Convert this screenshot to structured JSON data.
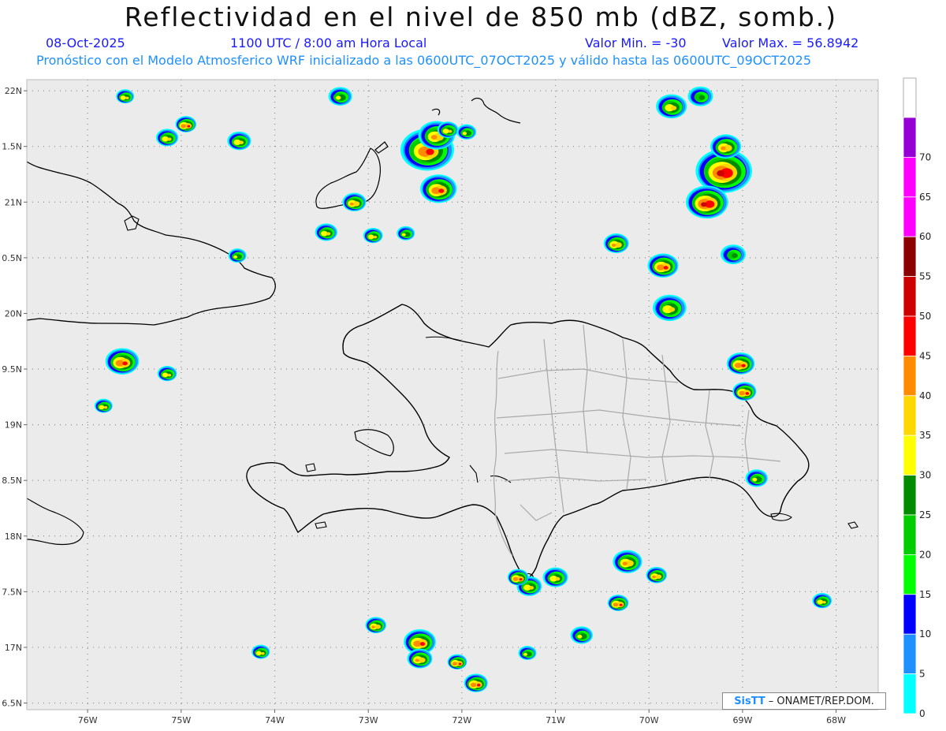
{
  "title": "Reflectividad en el nivel de 850 mb (dBZ, somb.)",
  "date": "08-Oct-2025",
  "time_label": "1100 UTC / 8:00 am Hora Local",
  "min_label": "Valor Min. = -30",
  "max_label": "Valor Max. = 56.8942",
  "forecast_label": "Pronóstico con el Modelo Atmosferico WRF inicializado a las 0600UTC_07OCT2025 y válido hasta las  0600UTC_09OCT2025",
  "credit": {
    "logo": "SisTT",
    "text": "– ONAMET/REP.DOM."
  },
  "map": {
    "lon_range": [
      -76.65,
      -67.55
    ],
    "lat_range": [
      16.44,
      22.1
    ],
    "lon_ticks": [
      {
        "value": -76,
        "label": "76W"
      },
      {
        "value": -75,
        "label": "75W"
      },
      {
        "value": -74,
        "label": "74W"
      },
      {
        "value": -73,
        "label": "73W"
      },
      {
        "value": -72,
        "label": "72W"
      },
      {
        "value": -71,
        "label": "71W"
      },
      {
        "value": -70,
        "label": "70W"
      },
      {
        "value": -69,
        "label": "69W"
      },
      {
        "value": -68,
        "label": "68W"
      }
    ],
    "lat_ticks": [
      {
        "value": 22,
        "label": "22N"
      },
      {
        "value": 21.5,
        "label": "1.5N"
      },
      {
        "value": 21,
        "label": "21N"
      },
      {
        "value": 20.5,
        "label": "0.5N"
      },
      {
        "value": 20,
        "label": "20N"
      },
      {
        "value": 19.5,
        "label": "9.5N"
      },
      {
        "value": 19,
        "label": "19N"
      },
      {
        "value": 18.5,
        "label": "8.5N"
      },
      {
        "value": 18,
        "label": "18N"
      },
      {
        "value": 17.5,
        "label": "7.5N"
      },
      {
        "value": 17,
        "label": "17N"
      },
      {
        "value": 16.5,
        "label": "6.5N"
      }
    ],
    "grid": true,
    "colors": {
      "background": "#ebebeb",
      "coast": "#000000",
      "borders": "#a9a9a9"
    }
  },
  "colorbar": {
    "labels": [
      "0",
      "5",
      "10",
      "15",
      "20",
      "25",
      "30",
      "35",
      "40",
      "45",
      "50",
      "55",
      "60",
      "65",
      "70"
    ],
    "colors": [
      "#00ffff",
      "#1e90ff",
      "#0000ff",
      "#00ff00",
      "#00cd00",
      "#008b00",
      "#ffff00",
      "#ffd700",
      "#ff8c00",
      "#ff0000",
      "#cd0000",
      "#8b0000",
      "#ff00ff",
      "#ff00ff",
      "#9400d3"
    ],
    "under_color": "#e6e6e6"
  },
  "storm_cells": [
    {
      "lon": -72.37,
      "lat": 21.47,
      "size": 3.0,
      "max": 48
    },
    {
      "lon": -72.27,
      "lat": 21.6,
      "size": 1.8,
      "max": 44
    },
    {
      "lon": -72.25,
      "lat": 21.12,
      "size": 1.8,
      "max": 46
    },
    {
      "lon": -69.2,
      "lat": 21.28,
      "size": 3.2,
      "max": 50
    },
    {
      "lon": -69.38,
      "lat": 21.0,
      "size": 2.2,
      "max": 50
    },
    {
      "lon": -69.18,
      "lat": 21.5,
      "size": 1.4,
      "max": 40
    },
    {
      "lon": -69.76,
      "lat": 21.86,
      "size": 1.4,
      "max": 38
    },
    {
      "lon": -69.45,
      "lat": 21.95,
      "size": 1.0,
      "max": 25
    },
    {
      "lon": -69.85,
      "lat": 20.43,
      "size": 1.4,
      "max": 46
    },
    {
      "lon": -70.35,
      "lat": 20.63,
      "size": 1.0,
      "max": 40
    },
    {
      "lon": -69.78,
      "lat": 20.05,
      "size": 1.6,
      "max": 38
    },
    {
      "lon": -69.02,
      "lat": 19.55,
      "size": 1.2,
      "max": 46
    },
    {
      "lon": -68.98,
      "lat": 19.3,
      "size": 0.9,
      "max": 48
    },
    {
      "lon": -69.1,
      "lat": 20.53,
      "size": 1.0,
      "max": 25
    },
    {
      "lon": -75.63,
      "lat": 19.57,
      "size": 1.6,
      "max": 48
    },
    {
      "lon": -75.15,
      "lat": 19.46,
      "size": 0.6,
      "max": 35
    },
    {
      "lon": -75.15,
      "lat": 21.58,
      "size": 0.8,
      "max": 38
    },
    {
      "lon": -74.95,
      "lat": 21.7,
      "size": 0.7,
      "max": 48
    },
    {
      "lon": -74.38,
      "lat": 21.55,
      "size": 0.9,
      "max": 38
    },
    {
      "lon": -73.45,
      "lat": 20.73,
      "size": 0.8,
      "max": 38
    },
    {
      "lon": -73.15,
      "lat": 21.0,
      "size": 0.9,
      "max": 40
    },
    {
      "lon": -73.3,
      "lat": 21.95,
      "size": 0.9,
      "max": 30
    },
    {
      "lon": -72.95,
      "lat": 20.7,
      "size": 0.6,
      "max": 38
    },
    {
      "lon": -72.15,
      "lat": 21.65,
      "size": 0.7,
      "max": 35
    },
    {
      "lon": -71.95,
      "lat": 21.63,
      "size": 0.6,
      "max": 30
    },
    {
      "lon": -72.45,
      "lat": 17.05,
      "size": 1.5,
      "max": 48
    },
    {
      "lon": -72.45,
      "lat": 16.9,
      "size": 1.0,
      "max": 42
    },
    {
      "lon": -72.92,
      "lat": 17.2,
      "size": 0.7,
      "max": 42
    },
    {
      "lon": -71.28,
      "lat": 17.55,
      "size": 1.0,
      "max": 35
    },
    {
      "lon": -71.0,
      "lat": 17.63,
      "size": 1.0,
      "max": 35
    },
    {
      "lon": -70.23,
      "lat": 17.77,
      "size": 1.3,
      "max": 42
    },
    {
      "lon": -70.33,
      "lat": 17.4,
      "size": 0.7,
      "max": 48
    },
    {
      "lon": -69.92,
      "lat": 17.65,
      "size": 0.7,
      "max": 42
    },
    {
      "lon": -70.72,
      "lat": 17.11,
      "size": 0.8,
      "max": 30
    },
    {
      "lon": -71.85,
      "lat": 16.68,
      "size": 0.9,
      "max": 48
    },
    {
      "lon": -71.4,
      "lat": 17.63,
      "size": 0.7,
      "max": 48
    },
    {
      "lon": -72.05,
      "lat": 16.87,
      "size": 0.6,
      "max": 45
    },
    {
      "lon": -68.85,
      "lat": 18.52,
      "size": 0.8,
      "max": 30
    },
    {
      "lon": -68.15,
      "lat": 17.42,
      "size": 0.6,
      "max": 38
    },
    {
      "lon": -74.15,
      "lat": 16.96,
      "size": 0.5,
      "max": 38
    },
    {
      "lon": -75.83,
      "lat": 19.17,
      "size": 0.5,
      "max": 38
    },
    {
      "lon": -75.6,
      "lat": 21.95,
      "size": 0.5,
      "max": 38
    },
    {
      "lon": -74.4,
      "lat": 20.52,
      "size": 0.5,
      "max": 30
    },
    {
      "lon": -72.6,
      "lat": 20.72,
      "size": 0.5,
      "max": 30
    },
    {
      "lon": -71.3,
      "lat": 16.95,
      "size": 0.5,
      "max": 30
    }
  ]
}
